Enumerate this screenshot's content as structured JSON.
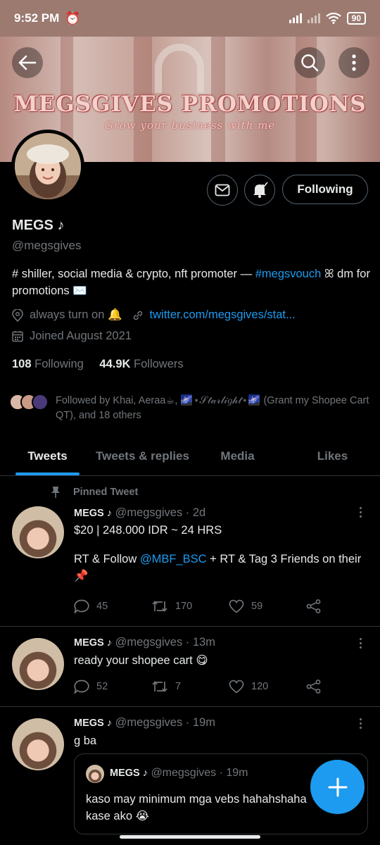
{
  "status_bar": {
    "time": "9:52 PM",
    "battery": "90"
  },
  "banner": {
    "title": "MEGSGIVES PROMOTIONS",
    "subtitle": "Grow your business with me"
  },
  "profile": {
    "name": "MEGS ♪",
    "handle": "@megsgives",
    "bio_part1": "# shiller, social media & crypto, nft promoter — ",
    "bio_link": "#megsvouch",
    "bio_part2": " ꕤ dm for promotions ✉️",
    "location": "always turn on 🔔",
    "website": "twitter.com/megsgives/stat...",
    "joined": "Joined August 2021",
    "following_count": "108",
    "following_label": "Following",
    "followers_count": "44.9K",
    "followers_label": "Followers",
    "followed_by": "Followed by Khai, Aeraa☕, 🌌⋆𝒮𝓉𝒶𝓇𝓁𝒾𝑔𝒽𝓉⋆🌌 (Grant my Shopee Cart QT), and 18 others",
    "following_button": "Following"
  },
  "tabs": [
    "Tweets",
    "Tweets & replies",
    "Media",
    "Likes"
  ],
  "pinned_label": "Pinned Tweet",
  "tweets": [
    {
      "name": "MEGS ♪",
      "handle": "@megsgives",
      "time": "· 2d",
      "line1": "$20 | 248.000 IDR ~ 24 HRS",
      "line2_pre": "RT & Follow ",
      "line2_link": "@MBF_BSC",
      "line2_post": " + RT & Tag 3 Friends on their 📌",
      "replies": "45",
      "retweets": "170",
      "likes": "59"
    },
    {
      "name": "MEGS ♪",
      "handle": "@megsgives",
      "time": "· 13m",
      "text": "ready your shopee cart 😋",
      "replies": "52",
      "retweets": "7",
      "likes": "120"
    },
    {
      "name": "MEGS ♪",
      "handle": "@megsgives",
      "time": "· 19m",
      "text": "g ba",
      "quote": {
        "name": "MEGS ♪",
        "handle": "@megsgives",
        "time": "· 19m",
        "text": "kaso may minimum mga vebs hahahshaha kase ako 😭"
      }
    }
  ],
  "colors": {
    "accent": "#1d9bf0",
    "background": "#000000",
    "muted": "#71767b"
  }
}
